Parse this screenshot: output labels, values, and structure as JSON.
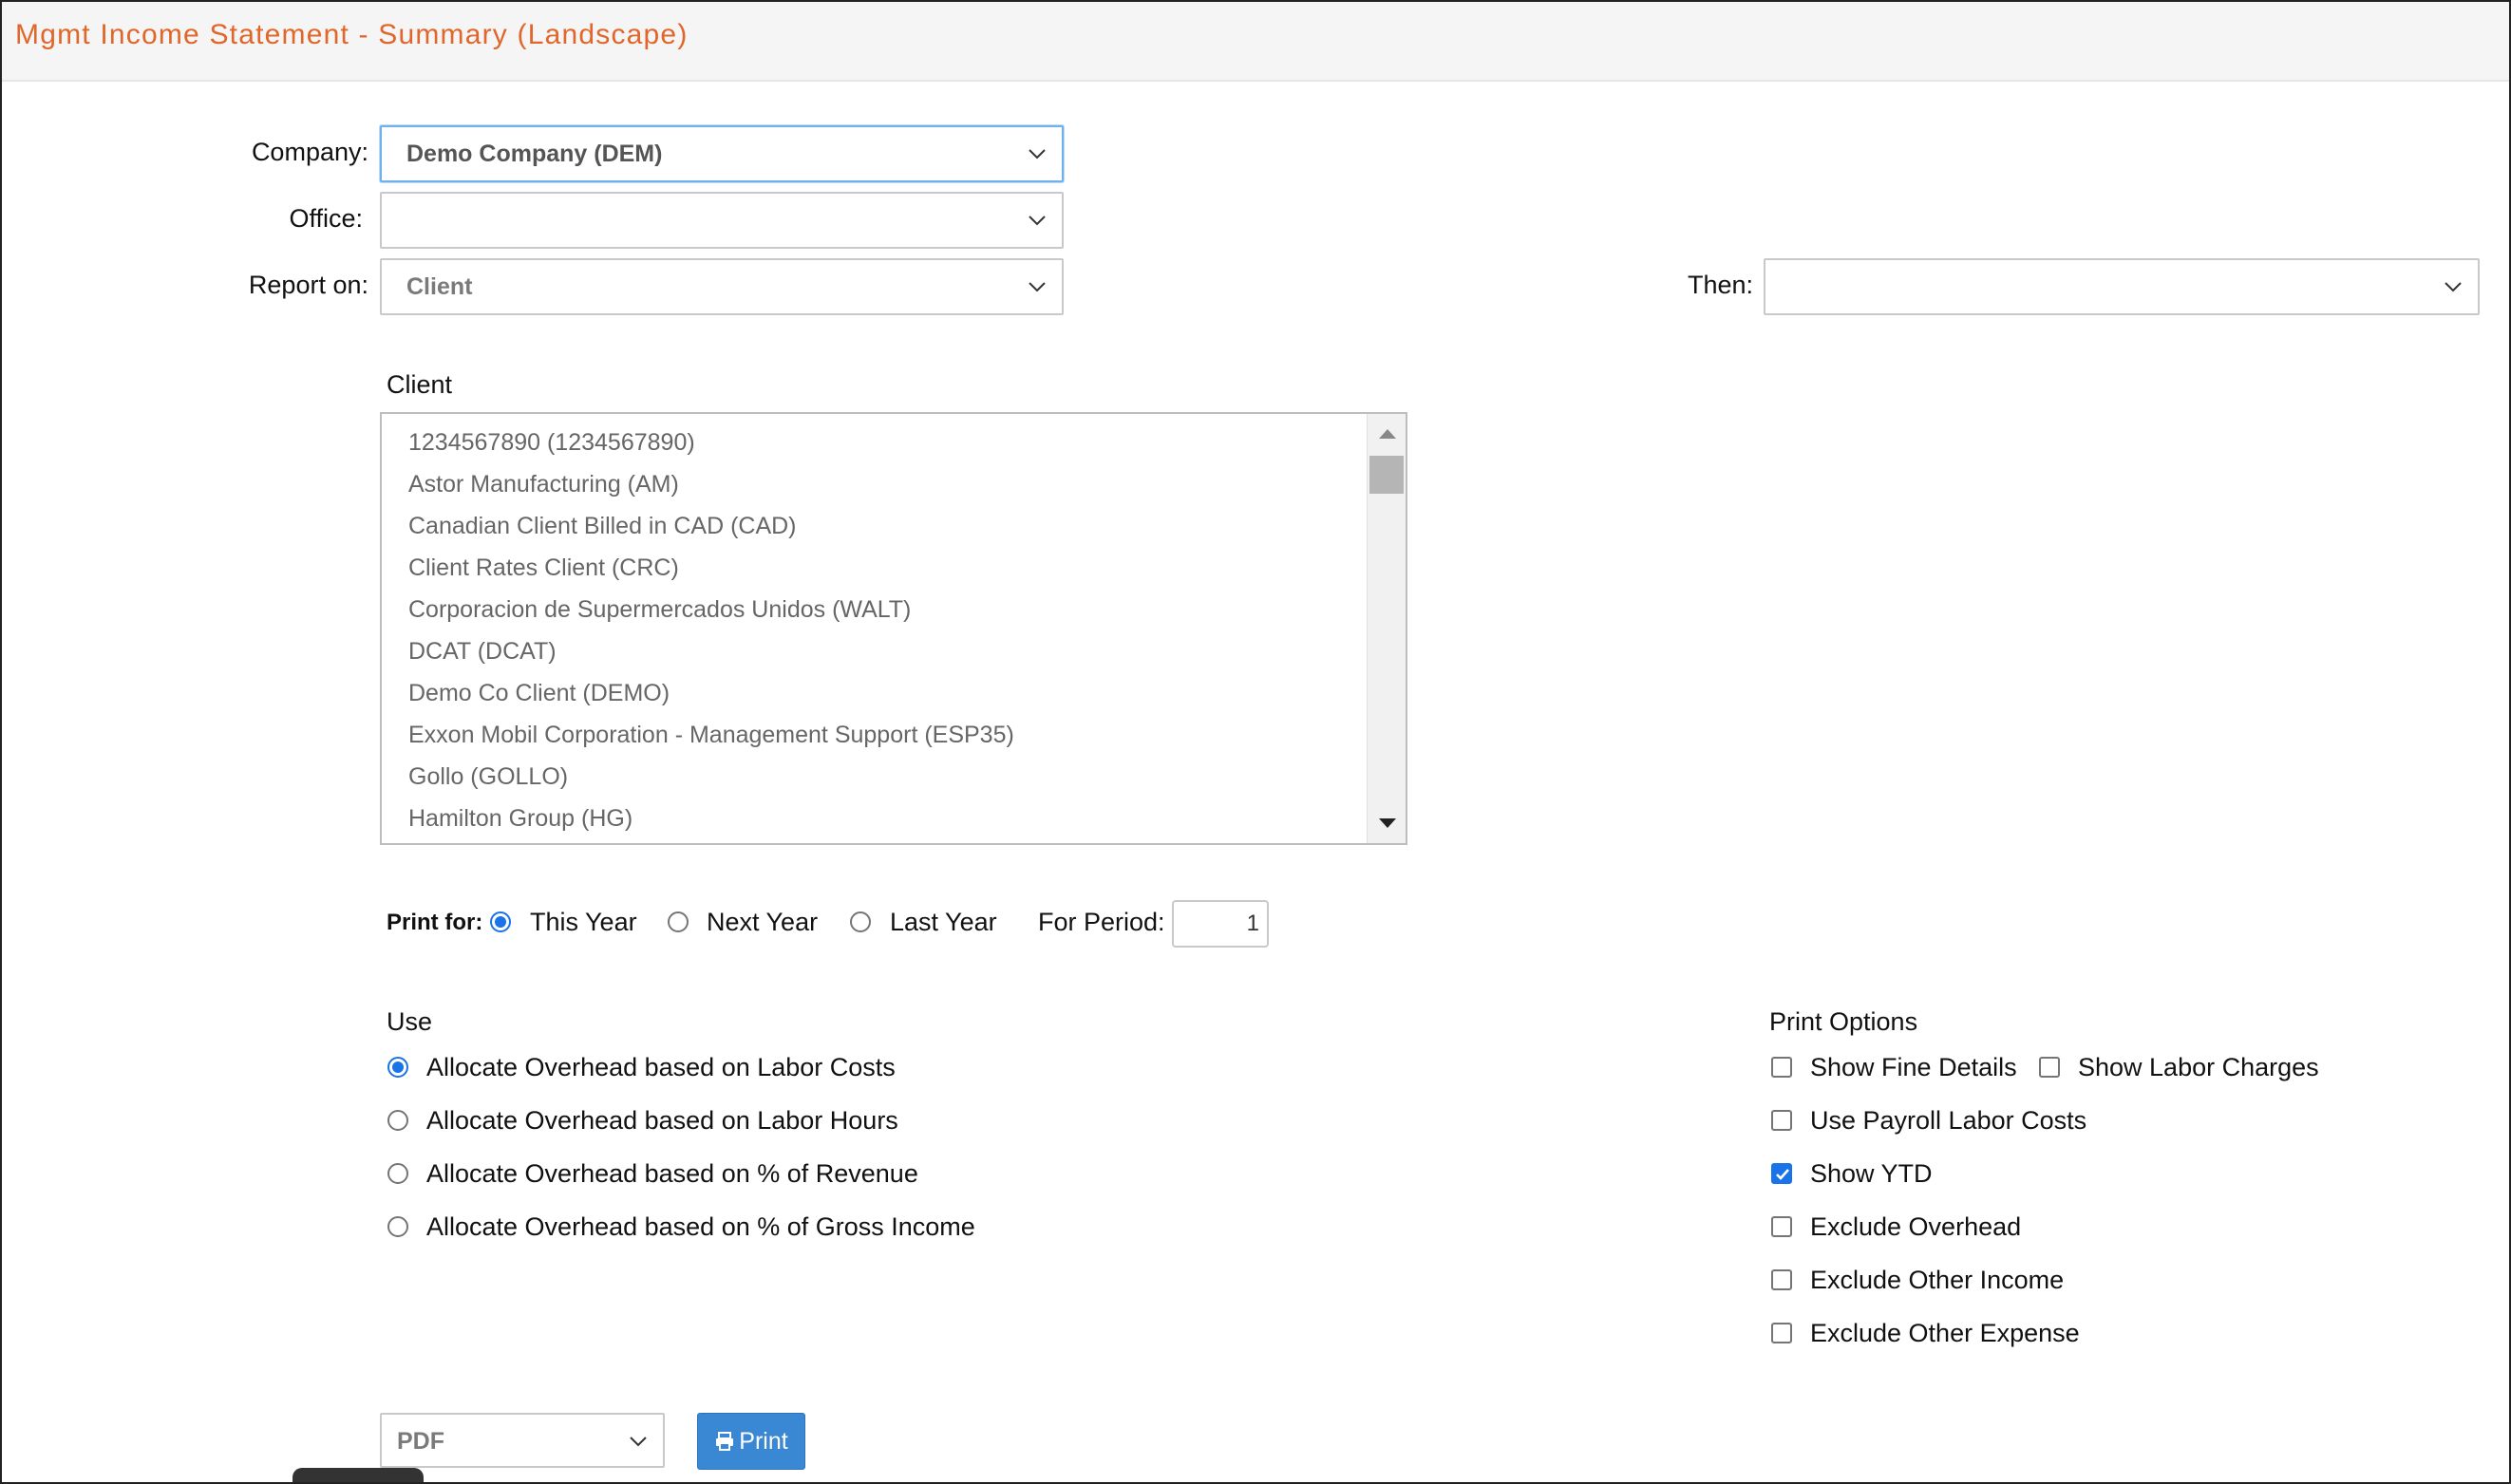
{
  "title": "Mgmt Income Statement - Summary (Landscape)",
  "company": {
    "label": "Company:",
    "value": "Demo Company (DEM)"
  },
  "office": {
    "label": "Office:",
    "value": ""
  },
  "report_on": {
    "label": "Report on:",
    "value": "Client"
  },
  "then": {
    "label": "Then:",
    "value": ""
  },
  "client_list": {
    "heading": "Client",
    "items": [
      "1234567890 (1234567890)",
      "Astor Manufacturing (AM)",
      "Canadian Client Billed in CAD (CAD)",
      "Client Rates Client (CRC)",
      "Corporacion de Supermercados Unidos (WALT)",
      "DCAT (DCAT)",
      "Demo Co Client (DEMO)",
      "Exxon Mobil Corporation - Management Support (ESP35)",
      "Gollo (GOLLO)",
      "Hamilton Group (HG)"
    ]
  },
  "print_for": {
    "label": "Print for:",
    "options": [
      "This Year",
      "Next Year",
      "Last Year"
    ],
    "selected": "This Year",
    "period_label": "For Period:",
    "period_value": "1"
  },
  "use": {
    "heading": "Use",
    "options": [
      "Allocate Overhead based on Labor Costs",
      "Allocate Overhead based on Labor Hours",
      "Allocate Overhead based on % of Revenue",
      "Allocate Overhead based on % of Gross Income"
    ],
    "selected": "Allocate Overhead based on Labor Costs"
  },
  "print_options": {
    "heading": "Print Options",
    "show_fine_details": "Show Fine Details",
    "show_labor_charges": "Show Labor Charges",
    "use_payroll_labor_costs": "Use Payroll Labor Costs",
    "show_ytd": "Show YTD",
    "exclude_overhead": "Exclude Overhead",
    "exclude_other_income": "Exclude Other Income",
    "exclude_other_expense": "Exclude Other Expense",
    "checked": [
      "Show YTD"
    ]
  },
  "output": {
    "format": "PDF",
    "print_label": "Print"
  },
  "colors": {
    "accent": "#1a73e8",
    "title": "#e0662a",
    "button": "#3a87d4"
  }
}
